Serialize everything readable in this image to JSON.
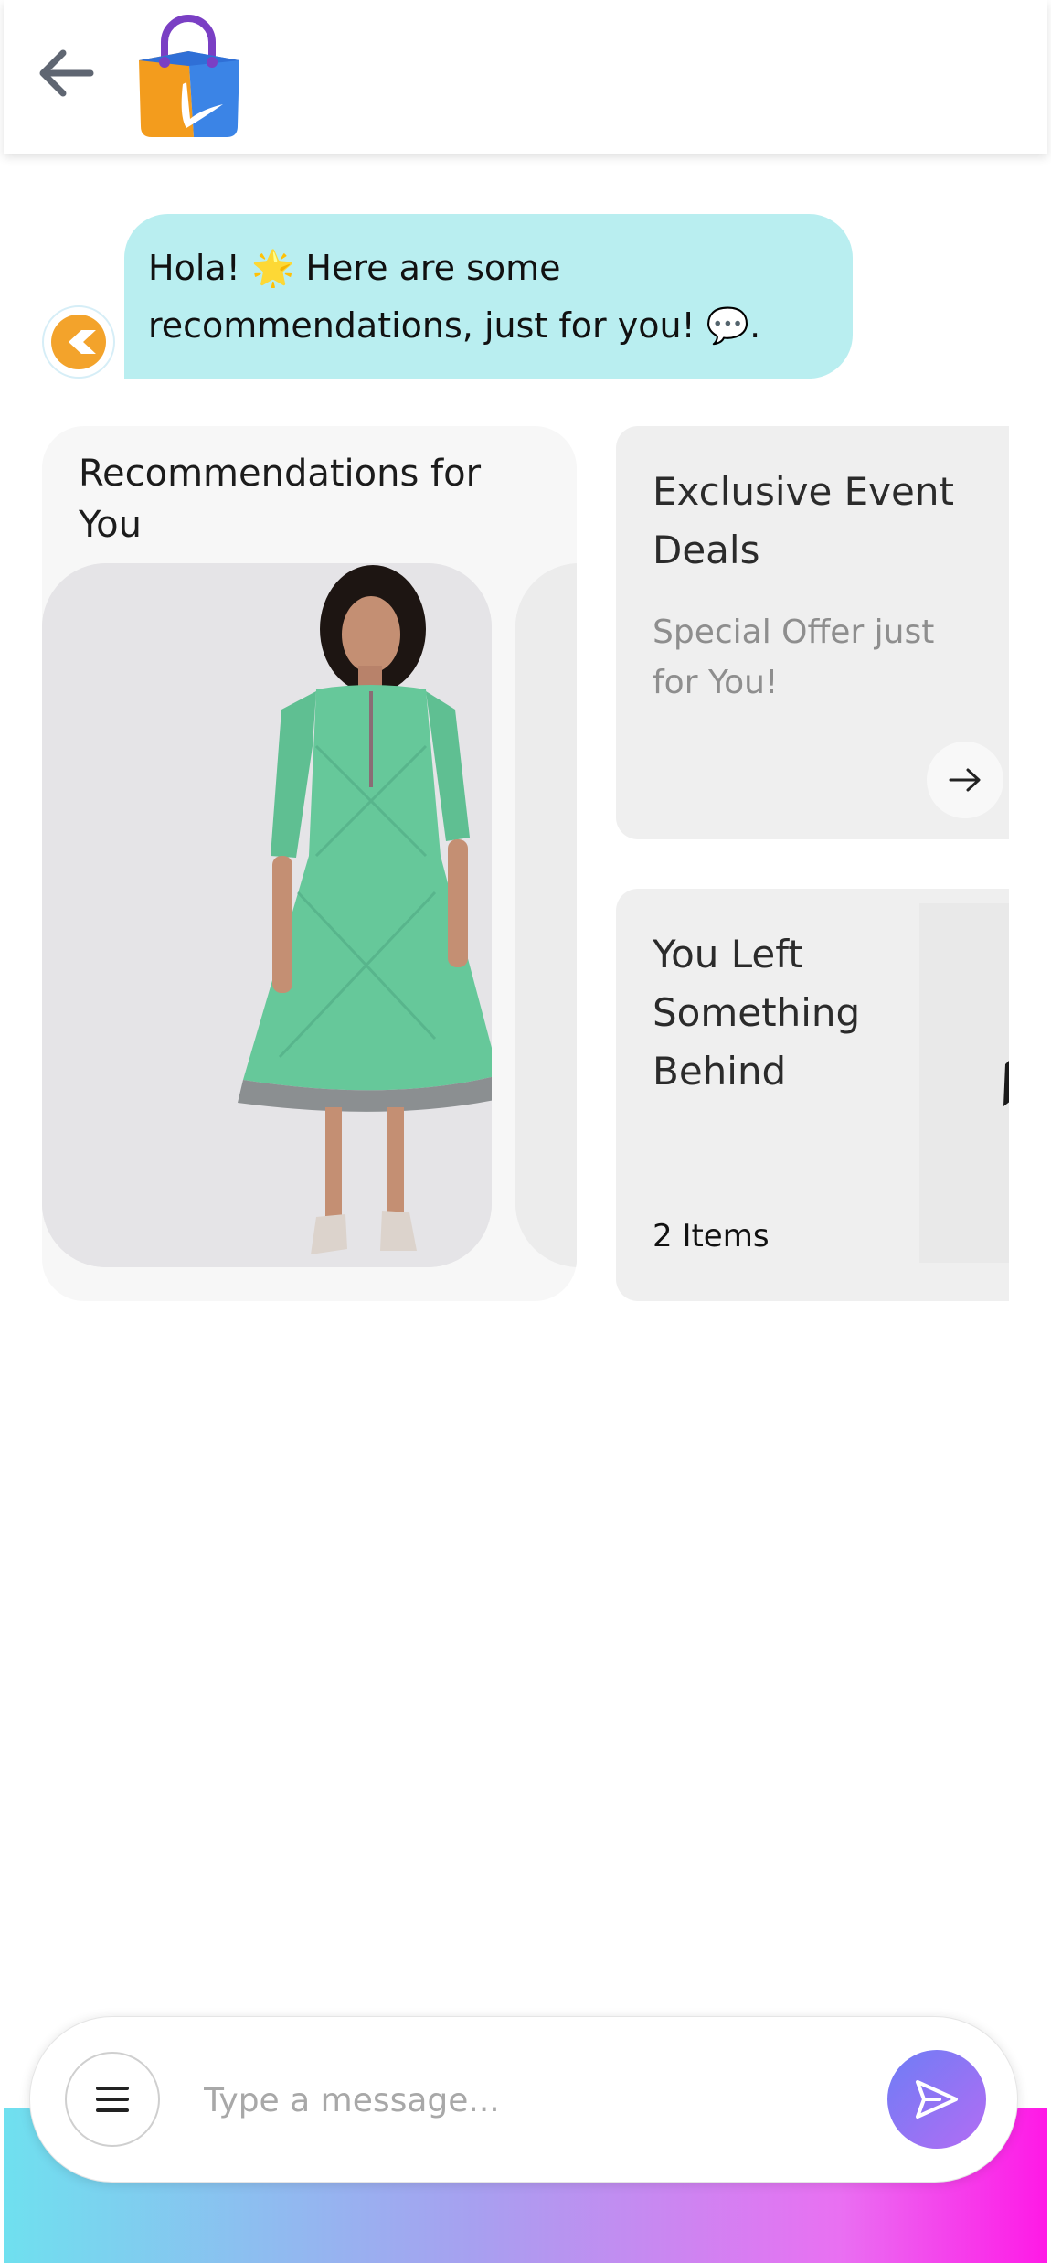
{
  "header": {
    "back_icon": "arrow-left-icon",
    "logo_icon": "shopping-bag-logo-icon"
  },
  "chat": {
    "message": "Hola! 🌟 Here are some recommendations, just for you! 💬.",
    "avatar_icon": "bot-avatar-icon"
  },
  "recommendations": {
    "title": "Recommendations for You",
    "products": [
      {
        "image": "green-dress-product-image"
      },
      {
        "image": "partial-product-image"
      }
    ]
  },
  "deal_card": {
    "title": "Exclusive Event Deals",
    "subtitle": "Special Offer just for You!",
    "arrow_icon": "arrow-right-icon"
  },
  "left_behind_card": {
    "title": "You Left Something Behind",
    "count": "2 Items"
  },
  "composer": {
    "placeholder": "Type a message...",
    "menu_icon": "hamburger-menu-icon",
    "send_icon": "send-icon"
  },
  "colors": {
    "bubble": "#b9eef0",
    "accent_gradient_start": "#6fe0ef",
    "accent_gradient_end": "#ff19e6",
    "send_start": "#6e7df5",
    "send_end": "#b36cf4"
  }
}
